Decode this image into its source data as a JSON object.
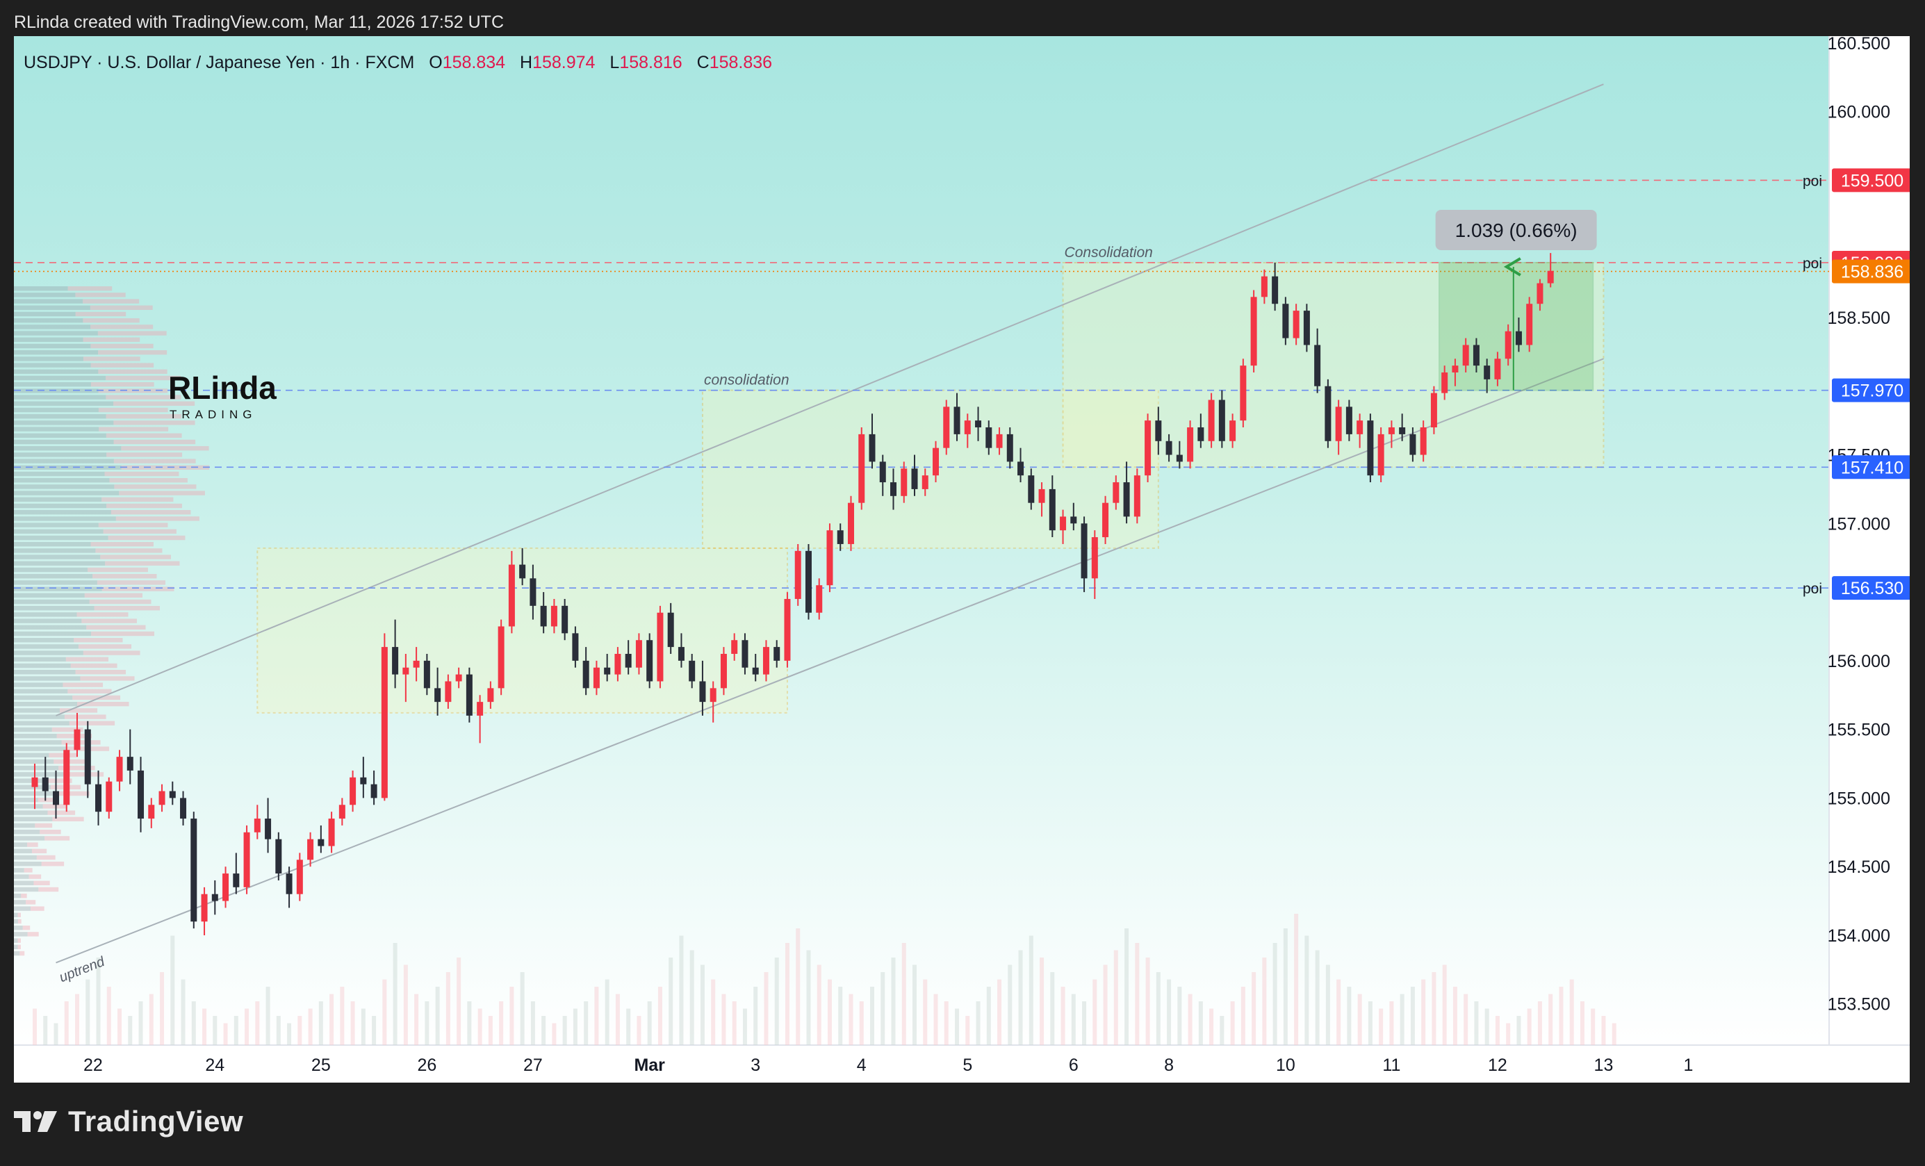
{
  "attribution": "RLinda created with TradingView.com, Mar 11, 2026 17:52 UTC",
  "brand": "TradingView",
  "chart_data": {
    "type": "candlestick",
    "symbol_line": "USDJPY · U.S. Dollar / Japanese Yen · 1h · FXCM",
    "ohlc": {
      "open_label": "O",
      "open": "158.834",
      "high_label": "H",
      "high": "158.974",
      "low_label": "L",
      "low": "158.816",
      "close_label": "C",
      "close": "158.836"
    },
    "watermark": {
      "main": "RLinda",
      "sub": "TRADING"
    },
    "y_ticks": [
      153.5,
      154.0,
      154.5,
      155.0,
      155.5,
      156.0,
      156.5,
      157.0,
      157.5,
      158.0,
      158.5,
      159.0,
      159.5,
      160.0,
      160.5
    ],
    "y_tick_labels": [
      "153.500",
      "154.000",
      "154.500",
      "155.000",
      "155.500",
      "156.000",
      "157.000",
      "158.500",
      "160.000",
      "160.500"
    ],
    "y_tick_values": [
      153.5,
      154.0,
      154.5,
      155.0,
      155.5,
      156.0,
      157.0,
      158.5,
      160.0,
      160.5
    ],
    "partial_label": "157.500",
    "partial_value": 157.5,
    "x_labels": [
      "22",
      "24",
      "25",
      "26",
      "27",
      "Mar",
      "3",
      "4",
      "5",
      "6",
      "8",
      "10",
      "11",
      "12",
      "13",
      "1"
    ],
    "x_label_index": [
      5.5,
      17,
      27,
      37,
      47,
      58,
      68,
      78,
      88,
      98,
      107,
      118,
      128,
      138,
      148,
      156
    ],
    "x_range": [
      0,
      158
    ],
    "ylim": [
      153.2,
      160.55
    ],
    "price_tags": [
      {
        "label": "159.500",
        "value": 159.5,
        "color": "#f23645",
        "note": "poi"
      },
      {
        "label": "158.900",
        "value": 158.9,
        "color": "#f23645",
        "note": "poi"
      },
      {
        "label": "158.836",
        "value": 158.836,
        "color": "#f57c00",
        "note": ""
      },
      {
        "label": "157.970",
        "value": 157.97,
        "color": "#2962ff",
        "note": ""
      },
      {
        "label": "157.410",
        "value": 157.41,
        "color": "#2962ff",
        "note": ""
      },
      {
        "label": "156.530",
        "value": 156.53,
        "color": "#2962ff",
        "note": "poi"
      }
    ],
    "zones": [
      {
        "label": "",
        "x0": 21,
        "x1": 71,
        "y0": 155.62,
        "y1": 156.82
      },
      {
        "label": "consolidation",
        "x0": 63,
        "x1": 106,
        "y0": 156.82,
        "y1": 157.97
      },
      {
        "label": "Consolidation",
        "x0": 97,
        "x1": 148,
        "y0": 157.41,
        "y1": 158.9
      }
    ],
    "channel": {
      "label": "uptrend",
      "lower": [
        [
          2,
          153.8
        ],
        [
          148,
          158.2
        ]
      ],
      "upper": [
        [
          2,
          155.6
        ],
        [
          148,
          160.2
        ]
      ]
    },
    "measure": {
      "label": "1.039 (0.66%)",
      "x0": 132.5,
      "x1": 147,
      "from": 157.97,
      "to": 158.9,
      "arrow_x": 139.5
    },
    "candles": [
      [
        155.08,
        155.25,
        154.92,
        155.15
      ],
      [
        155.15,
        155.3,
        154.98,
        155.05
      ],
      [
        155.05,
        155.2,
        154.85,
        154.95
      ],
      [
        154.95,
        155.4,
        154.9,
        155.35
      ],
      [
        155.35,
        155.62,
        155.3,
        155.5
      ],
      [
        155.5,
        155.56,
        155.0,
        155.1
      ],
      [
        155.1,
        155.2,
        154.8,
        154.9
      ],
      [
        154.9,
        155.15,
        154.85,
        155.12
      ],
      [
        155.12,
        155.35,
        155.05,
        155.3
      ],
      [
        155.3,
        155.5,
        155.1,
        155.2
      ],
      [
        155.2,
        155.3,
        154.75,
        154.85
      ],
      [
        154.85,
        155.0,
        154.78,
        154.95
      ],
      [
        154.95,
        155.1,
        154.9,
        155.05
      ],
      [
        155.05,
        155.12,
        154.95,
        155.0
      ],
      [
        155.0,
        155.05,
        154.8,
        154.85
      ],
      [
        154.85,
        154.9,
        154.05,
        154.1
      ],
      [
        154.1,
        154.35,
        154.0,
        154.3
      ],
      [
        154.3,
        154.4,
        154.15,
        154.25
      ],
      [
        154.25,
        154.5,
        154.2,
        154.45
      ],
      [
        154.45,
        154.6,
        154.3,
        154.35
      ],
      [
        154.35,
        154.8,
        154.3,
        154.75
      ],
      [
        154.75,
        154.95,
        154.7,
        154.85
      ],
      [
        154.85,
        155.0,
        154.6,
        154.7
      ],
      [
        154.7,
        154.75,
        154.4,
        154.45
      ],
      [
        154.45,
        154.5,
        154.2,
        154.3
      ],
      [
        154.3,
        154.6,
        154.25,
        154.55
      ],
      [
        154.55,
        154.75,
        154.5,
        154.7
      ],
      [
        154.7,
        154.8,
        154.6,
        154.65
      ],
      [
        154.65,
        154.9,
        154.6,
        154.85
      ],
      [
        154.85,
        155.0,
        154.8,
        154.95
      ],
      [
        154.95,
        155.2,
        154.9,
        155.15
      ],
      [
        155.15,
        155.3,
        155.0,
        155.1
      ],
      [
        155.1,
        155.2,
        154.95,
        155.0
      ],
      [
        155.0,
        156.2,
        154.98,
        156.1
      ],
      [
        156.1,
        156.3,
        155.8,
        155.9
      ],
      [
        155.9,
        156.05,
        155.7,
        155.95
      ],
      [
        155.95,
        156.1,
        155.85,
        156.0
      ],
      [
        156.0,
        156.05,
        155.75,
        155.8
      ],
      [
        155.8,
        155.95,
        155.6,
        155.7
      ],
      [
        155.7,
        155.9,
        155.65,
        155.85
      ],
      [
        155.85,
        155.95,
        155.8,
        155.9
      ],
      [
        155.9,
        155.95,
        155.55,
        155.6
      ],
      [
        155.6,
        155.75,
        155.4,
        155.7
      ],
      [
        155.7,
        155.85,
        155.65,
        155.8
      ],
      [
        155.8,
        156.3,
        155.75,
        156.25
      ],
      [
        156.25,
        156.8,
        156.2,
        156.7
      ],
      [
        156.7,
        156.82,
        156.55,
        156.6
      ],
      [
        156.6,
        156.7,
        156.3,
        156.4
      ],
      [
        156.4,
        156.5,
        156.2,
        156.25
      ],
      [
        156.25,
        156.45,
        156.2,
        156.4
      ],
      [
        156.4,
        156.45,
        156.15,
        156.2
      ],
      [
        156.2,
        156.25,
        155.95,
        156.0
      ],
      [
        156.0,
        156.1,
        155.75,
        155.8
      ],
      [
        155.8,
        156.0,
        155.75,
        155.95
      ],
      [
        155.95,
        156.05,
        155.85,
        155.9
      ],
      [
        155.9,
        156.1,
        155.85,
        156.05
      ],
      [
        156.05,
        156.15,
        155.9,
        155.95
      ],
      [
        155.95,
        156.2,
        155.9,
        156.15
      ],
      [
        156.15,
        156.2,
        155.8,
        155.85
      ],
      [
        155.85,
        156.4,
        155.8,
        156.35
      ],
      [
        156.35,
        156.42,
        156.05,
        156.1
      ],
      [
        156.1,
        156.2,
        155.95,
        156.0
      ],
      [
        156.0,
        156.05,
        155.8,
        155.85
      ],
      [
        155.85,
        156.0,
        155.6,
        155.7
      ],
      [
        155.7,
        155.85,
        155.55,
        155.8
      ],
      [
        155.8,
        156.1,
        155.75,
        156.05
      ],
      [
        156.05,
        156.2,
        156.0,
        156.15
      ],
      [
        156.15,
        156.2,
        155.9,
        155.95
      ],
      [
        155.95,
        156.05,
        155.85,
        155.9
      ],
      [
        155.9,
        156.15,
        155.85,
        156.1
      ],
      [
        156.1,
        156.15,
        155.95,
        156.0
      ],
      [
        156.0,
        156.5,
        155.95,
        156.45
      ],
      [
        156.45,
        156.85,
        156.4,
        156.8
      ],
      [
        156.8,
        156.85,
        156.3,
        156.35
      ],
      [
        156.35,
        156.6,
        156.3,
        156.55
      ],
      [
        156.55,
        157.0,
        156.5,
        156.95
      ],
      [
        156.95,
        157.0,
        156.8,
        156.85
      ],
      [
        156.85,
        157.2,
        156.8,
        157.15
      ],
      [
        157.15,
        157.7,
        157.1,
        157.65
      ],
      [
        157.65,
        157.8,
        157.4,
        157.45
      ],
      [
        157.45,
        157.5,
        157.2,
        157.3
      ],
      [
        157.3,
        157.4,
        157.1,
        157.2
      ],
      [
        157.2,
        157.45,
        157.15,
        157.4
      ],
      [
        157.4,
        157.5,
        157.2,
        157.25
      ],
      [
        157.25,
        157.4,
        157.2,
        157.35
      ],
      [
        157.35,
        157.6,
        157.3,
        157.55
      ],
      [
        157.55,
        157.9,
        157.5,
        157.85
      ],
      [
        157.85,
        157.95,
        157.6,
        157.65
      ],
      [
        157.65,
        157.8,
        157.55,
        157.75
      ],
      [
        157.75,
        157.85,
        157.6,
        157.7
      ],
      [
        157.7,
        157.75,
        157.5,
        157.55
      ],
      [
        157.55,
        157.7,
        157.5,
        157.65
      ],
      [
        157.65,
        157.7,
        157.4,
        157.45
      ],
      [
        157.45,
        157.55,
        157.3,
        157.35
      ],
      [
        157.35,
        157.4,
        157.1,
        157.15
      ],
      [
        157.15,
        157.3,
        157.05,
        157.25
      ],
      [
        157.25,
        157.35,
        156.9,
        156.95
      ],
      [
        156.95,
        157.1,
        156.85,
        157.05
      ],
      [
        157.05,
        157.15,
        156.95,
        157.0
      ],
      [
        157.0,
        157.05,
        156.5,
        156.6
      ],
      [
        156.6,
        156.95,
        156.45,
        156.9
      ],
      [
        156.9,
        157.2,
        156.85,
        157.15
      ],
      [
        157.15,
        157.35,
        157.1,
        157.3
      ],
      [
        157.3,
        157.45,
        157.0,
        157.05
      ],
      [
        157.05,
        157.4,
        157.0,
        157.35
      ],
      [
        157.35,
        157.8,
        157.3,
        157.75
      ],
      [
        157.75,
        157.85,
        157.5,
        157.6
      ],
      [
        157.6,
        157.65,
        157.45,
        157.5
      ],
      [
        157.5,
        157.6,
        157.4,
        157.45
      ],
      [
        157.45,
        157.75,
        157.4,
        157.7
      ],
      [
        157.7,
        157.8,
        157.55,
        157.6
      ],
      [
        157.6,
        157.95,
        157.55,
        157.9
      ],
      [
        157.9,
        157.97,
        157.55,
        157.6
      ],
      [
        157.6,
        157.8,
        157.55,
        157.75
      ],
      [
        157.75,
        158.2,
        157.7,
        158.15
      ],
      [
        158.15,
        158.7,
        158.1,
        158.65
      ],
      [
        158.65,
        158.85,
        158.6,
        158.8
      ],
      [
        158.8,
        158.9,
        158.55,
        158.6
      ],
      [
        158.6,
        158.65,
        158.3,
        158.35
      ],
      [
        158.35,
        158.6,
        158.3,
        158.55
      ],
      [
        158.55,
        158.6,
        158.25,
        158.3
      ],
      [
        158.3,
        158.42,
        157.95,
        158.0
      ],
      [
        158.0,
        158.05,
        157.55,
        157.6
      ],
      [
        157.6,
        157.9,
        157.5,
        157.85
      ],
      [
        157.85,
        157.9,
        157.6,
        157.65
      ],
      [
        157.65,
        157.8,
        157.55,
        157.75
      ],
      [
        157.75,
        157.8,
        157.3,
        157.35
      ],
      [
        157.35,
        157.7,
        157.3,
        157.65
      ],
      [
        157.65,
        157.75,
        157.55,
        157.7
      ],
      [
        157.7,
        157.8,
        157.6,
        157.65
      ],
      [
        157.65,
        157.7,
        157.45,
        157.5
      ],
      [
        157.5,
        157.75,
        157.45,
        157.7
      ],
      [
        157.7,
        158.0,
        157.65,
        157.95
      ],
      [
        157.95,
        158.15,
        157.9,
        158.1
      ],
      [
        158.1,
        158.2,
        158.0,
        158.15
      ],
      [
        158.15,
        158.35,
        158.1,
        158.3
      ],
      [
        158.3,
        158.35,
        158.1,
        158.15
      ],
      [
        158.15,
        158.2,
        157.95,
        158.05
      ],
      [
        158.05,
        158.25,
        158.0,
        158.2
      ],
      [
        158.2,
        158.45,
        158.15,
        158.4
      ],
      [
        158.4,
        158.5,
        158.25,
        158.3
      ],
      [
        158.3,
        158.65,
        158.25,
        158.6
      ],
      [
        158.6,
        158.78,
        158.55,
        158.75
      ],
      [
        158.75,
        158.97,
        158.72,
        158.84
      ]
    ],
    "volumes": [
      50,
      40,
      30,
      60,
      70,
      90,
      120,
      80,
      50,
      40,
      60,
      70,
      100,
      150,
      90,
      60,
      50,
      40,
      30,
      40,
      50,
      60,
      80,
      40,
      30,
      40,
      50,
      60,
      70,
      80,
      60,
      50,
      40,
      90,
      140,
      110,
      70,
      60,
      80,
      100,
      120,
      60,
      50,
      40,
      60,
      80,
      100,
      60,
      40,
      30,
      40,
      50,
      60,
      80,
      90,
      70,
      50,
      40,
      60,
      80,
      120,
      150,
      130,
      110,
      90,
      70,
      60,
      50,
      80,
      100,
      120,
      140,
      160,
      130,
      110,
      90,
      80,
      70,
      60,
      80,
      100,
      120,
      140,
      110,
      90,
      70,
      60,
      50,
      40,
      60,
      80,
      90,
      110,
      130,
      150,
      120,
      100,
      80,
      70,
      60,
      90,
      110,
      130,
      160,
      140,
      120,
      100,
      90,
      80,
      70,
      60,
      50,
      40,
      60,
      80,
      100,
      120,
      140,
      160,
      180,
      150,
      130,
      110,
      90,
      80,
      70,
      60,
      50,
      60,
      70,
      80,
      90,
      100,
      110,
      80,
      70,
      60,
      50,
      40,
      30,
      40,
      50,
      60,
      70,
      80,
      90,
      60,
      50,
      40,
      30
    ]
  }
}
